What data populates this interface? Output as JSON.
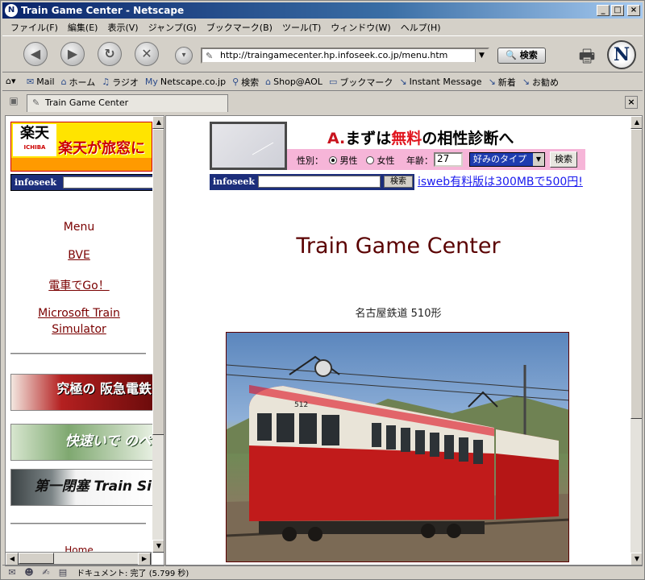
{
  "window": {
    "title": "Train Game Center - Netscape"
  },
  "menu": [
    "ファイル(F)",
    "編集(E)",
    "表示(V)",
    "ジャンプ(G)",
    "ブックマーク(B)",
    "ツール(T)",
    "ウィンドウ(W)",
    "ヘルプ(H)"
  ],
  "nav": {
    "url": "http://traingamecenter.hp.infoseek.co.jp/menu.htm",
    "search_label": "検索"
  },
  "personal_toolbar": [
    "Mail",
    "ホーム",
    "ラジオ",
    "Netscape.co.jp",
    "検索",
    "Shop@AOL",
    "ブックマーク",
    "Instant Message",
    "新着",
    "お勧め"
  ],
  "tab": {
    "label": "Train Game Center"
  },
  "left_frame": {
    "rakuten": {
      "logo": "楽天",
      "logo_sub": "ICHIBA",
      "slogan": "楽天が旅窓に"
    },
    "infoseek_label": "infoseek",
    "menu_heading": "Menu",
    "links": [
      "BVE",
      "電車でGo！",
      "Microsoft Train Simulator"
    ],
    "banners": [
      {
        "text": "究極の 阪急電鉄",
        "color": "#7a1010"
      },
      {
        "text": "快速いで のペ",
        "color": "#1d5e22"
      },
      {
        "text": "第一閉塞 Train Si",
        "color": "#1a1a1a"
      }
    ],
    "bottom_link": "Home"
  },
  "right_frame": {
    "ad": {
      "headline_a": "A.",
      "headline_pre": "まずは",
      "headline_red": "無料",
      "headline_post": "の相性診断へ",
      "gender_label": "性別：",
      "male": "男性",
      "female": "女性",
      "age_label": "年齢：",
      "age_value": "27",
      "type_select": "好みのタイプ",
      "go_button": "検索"
    },
    "infoseek_label": "infoseek",
    "infoseek_button": "検索",
    "isweb_link": "isweb有料版は300MBで500円!",
    "title": "Train Game Center",
    "caption": "名古屋鉄道 510形",
    "train_number": "512"
  },
  "status": {
    "text": "ドキュメント: 完了 (5.799 秒)"
  },
  "colors": {
    "title_bar": "#0a246a",
    "link": "#7a0000",
    "ad_pink": "#f6b5d8",
    "train_red": "#c11b1b"
  }
}
